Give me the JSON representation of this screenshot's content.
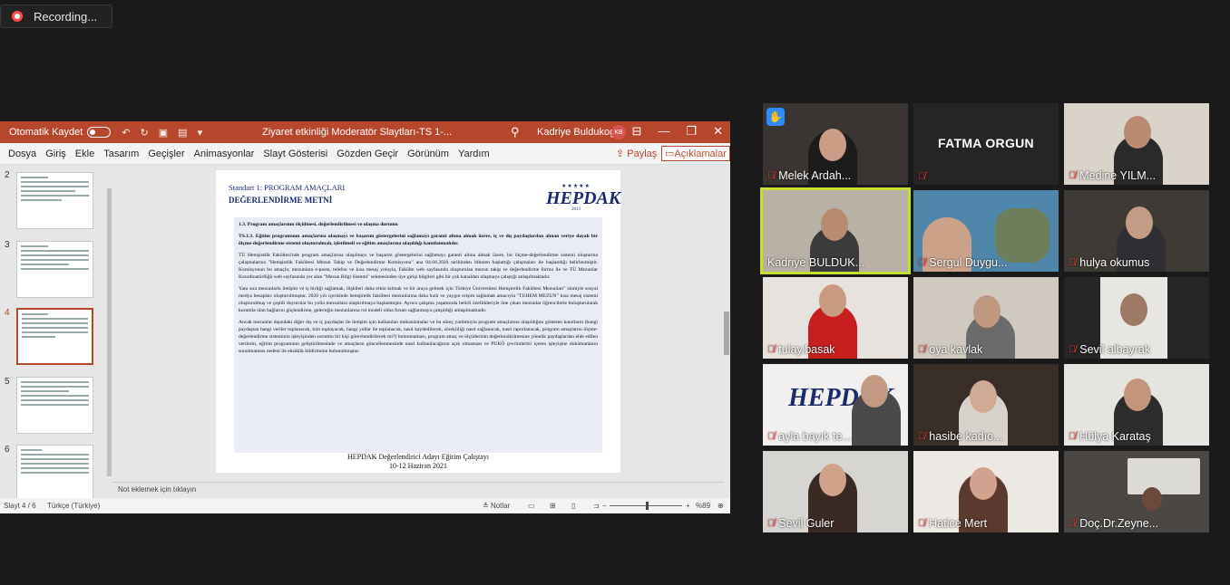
{
  "recording": {
    "label": "Recording..."
  },
  "ppt": {
    "autosave_label": "Otomatik Kaydet",
    "doc_title": "Ziyaret etkinliği Moderatör Slaytları-TS 1-...",
    "user_name": "Kadriye Buldukoglu",
    "user_initials": "KB",
    "menu": [
      "Dosya",
      "Giriş",
      "Ekle",
      "Tasarım",
      "Geçişler",
      "Animasyonlar",
      "Slayt Gösterisi",
      "Gözden Geçir",
      "Görünüm",
      "Yardım"
    ],
    "share_label": "Paylaş",
    "comments_label": "Açıklamalar",
    "thumb_numbers": [
      "2",
      "3",
      "4",
      "5",
      "6"
    ],
    "notes_placeholder": "Not eklemek için tıklayın",
    "status": {
      "slide": "Slayt 4 / 6",
      "language": "Türkçe (Türkiye)",
      "notes": "Notlar",
      "zoom": "%89"
    }
  },
  "slide": {
    "header": "Standart 1: PROGRAM AMAÇLARI",
    "subheader": "DEĞERLENDİRME METNİ",
    "logo": {
      "stars": "★★★★★",
      "text": "HEPDAK",
      "year": "2013"
    },
    "box_title": "1.3. Program amaçlarının ölçülmesi, değerlendirilmesi ve ulaşma durumu",
    "box_standard": "TS.1.3. Eğitim programının amaçlarına ulaşmayı ve başarım göstergelerini sağlamayı garanti altına almak üzere, iç ve dış paydaşlardan alınan veriye dayalı bir ölçme-değerlendirme sistemi oluşturulmalı, işletilmeli ve eğitim amaçlarına ulaşıldığı kanıtlanmalıdır.",
    "para1": "TÜ Hemşirelik Fakültesi'nde program amaçlarına ulaşılmayı ve başarım göstergelerini sağlamayı garanti altına almak üzere, bir ölçme-değerlendirme sistemi oluşturma çalışmalarına \"Hemşirelik Fakültesi Mezun Takip ve Değerlendirme Komisyonu\" ana 04.04.2020 tarihinden itibaren başlattığı çalışmaları ile başlandığı belirlenmiştir. Komisyonun bu amaçla; mezunlara e-posta, telefon ve kısa mesaj yoluyla, Fakülte web sayfasında oluşturulan mezun takip ve değerlendirme formu ile ve TÜ Mezunlar Koordinatörlüğü web sayfasında yer alan \"Mezun Bilgi Sistemi\" sekmesinden üye girişi bilgileri gibi bir çok kanaldan ulaşmaya çalıştığı anlaşılmaktadır.",
    "para2": "Yanı sıra mezunlarla iletişim ve iş birliği sağlamak, ilişkileri daha etkin kılmak ve bir araya gelmek için Türkiye Üniversitesi Hemşirelik Fakültesi Mezunları\" isimiyle sosyal medya hesapları oluşturulmuştur. 2020 yılı içerisinde hemşirelik fakültesi mezunlarına daha hızlı ve yaygın erişim sağlamak amacıyla \"TUHEM MEZUN\" kısa mesaj sistemi oluşturulmuş ve çeşitli duyurular bu yolla mezunlara ulaştırılmaya başlanmıştır. Ayrıca çalışma yaşamında belirli özellikleriyle öne çıkan mezunlar öğrencilerle buluşturularak kurumla olan bağlarını güçlendirme, geleceğin mezunlarına rol modeli olma fırsatı sağlanmaya çalışıldığı anlaşılmaktadır.",
    "para3": "Ancak mezunlar dışındaki diğer dış ve iç paydaşlar ile iletişim için kullanılan mekanizmalar ve bu süreç yardımıyla program amaçlarına ulaşıldığını gösteren kanıtların (hangi paydaştan hangi veriler toplanacak, kim toplayacak, hangi yollar ile toplanacak, nasıl kaydedilecek, sürekliliği nasıl sağlanacak, nasıl raporlanacak, program amaçlarını ölçme-değerlendirme sisteminin işleyişinden sorumlu bir kişi görevlendirilecek mi?) bulunmaması, program amaç ve ölçütlerinin değerlendirilmesine yönelik paydaşlardan elde edilen verilerin, eğitim programının geliştirilmesinde ve amaçların güncellenmesinde nasıl kullanılacağının açık olmaması ve PUKÖ çevrimlerini içeren işleyişine dokümanların sunulmaması nedeni ile eksiklik bildirimine bulunulmuştur.",
    "footer1": "HEPDAK Değerlendirici Adayı Eğitim Çalıştayı",
    "footer2": "10-12 Haziran 2021"
  },
  "participants": [
    {
      "name": "Melek Ardah...",
      "raised_hand": true
    },
    {
      "name": "FATMA ORGUN",
      "video_off": true
    },
    {
      "name": "Medine YILM..."
    },
    {
      "name": "Kadriye BULDUK...",
      "active_speaker": true
    },
    {
      "name": "Sergul Duygu..."
    },
    {
      "name": "hulya okumus"
    },
    {
      "name": "tulay.basak"
    },
    {
      "name": "oya kavlak"
    },
    {
      "name": "Sevil albayrak"
    },
    {
      "name": "ayla bayık te..."
    },
    {
      "name": "hasibe kadıo..."
    },
    {
      "name": "Hülya Karataş"
    },
    {
      "name": "Sevil Guler"
    },
    {
      "name": "Hatice Mert"
    },
    {
      "name": "Doç.Dr.Zeyne..."
    }
  ],
  "colors": {
    "ppt_accent": "#b7472a",
    "active_speaker": "#c6e032",
    "mic_off": "#ff3b30",
    "raised_hand": "#2d8cff"
  }
}
